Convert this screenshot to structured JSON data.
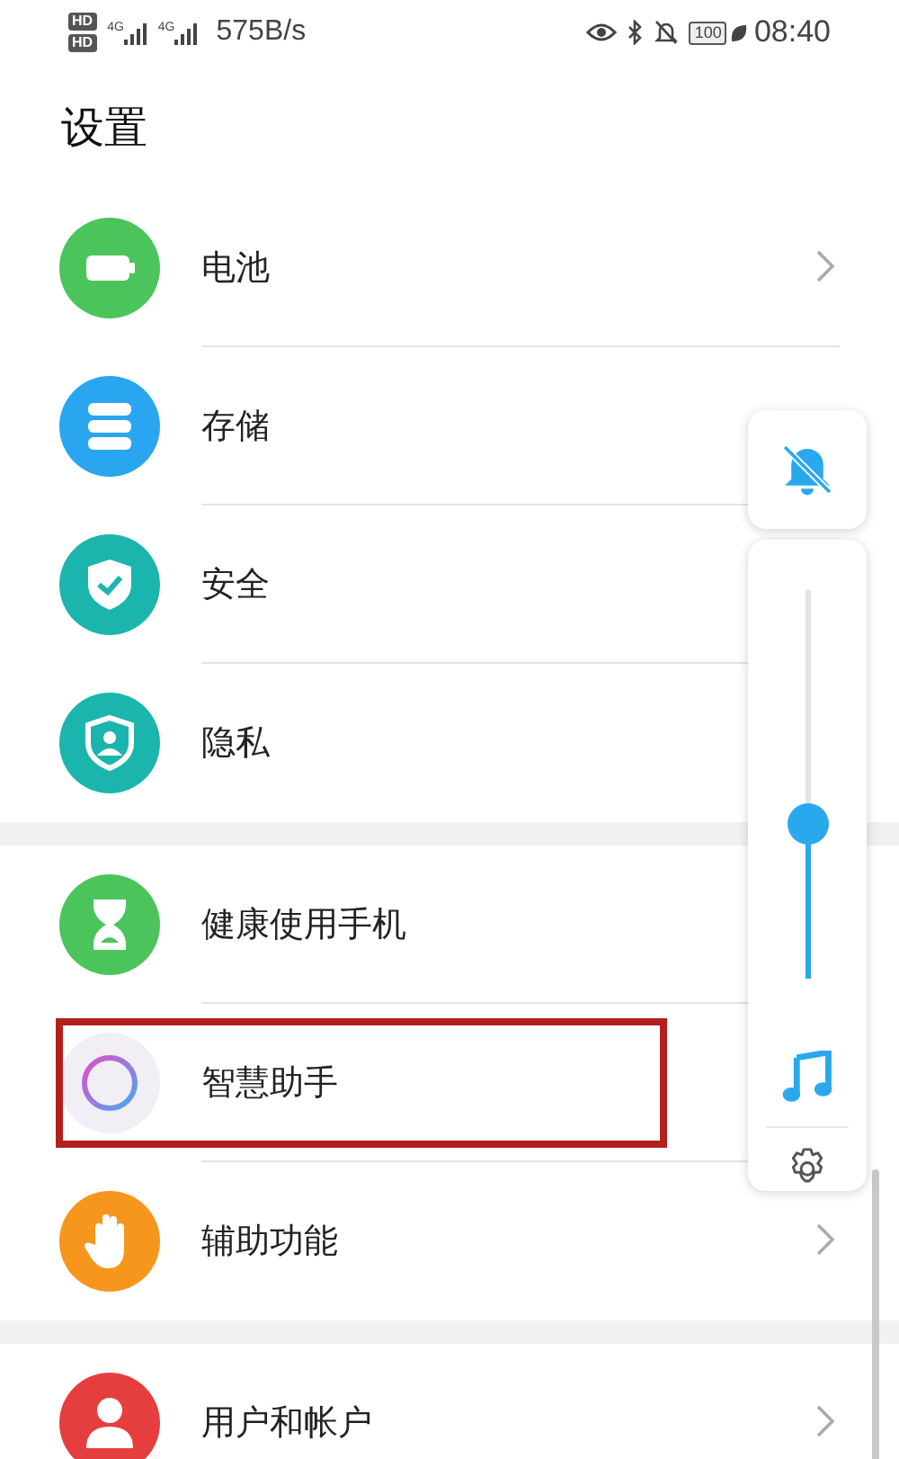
{
  "status_bar": {
    "hd_badges": [
      "HD",
      "HD"
    ],
    "network_types": [
      "4G",
      "4G"
    ],
    "speed": "575B/s",
    "battery": "100",
    "time": "08:40"
  },
  "title": "设置",
  "groups": [
    {
      "rows": [
        {
          "kind": "battery",
          "label": "电池",
          "color": "#4cc45c",
          "chevron": true,
          "highlighted": false
        },
        {
          "kind": "storage",
          "label": "存储",
          "color": "#2aa5f0",
          "chevron": false,
          "highlighted": false
        },
        {
          "kind": "security",
          "label": "安全",
          "color": "#1bb5ad",
          "chevron": false,
          "highlighted": false
        },
        {
          "kind": "privacy",
          "label": "隐私",
          "color": "#1bb5ad",
          "chevron": false,
          "highlighted": false
        }
      ]
    },
    {
      "rows": [
        {
          "kind": "health",
          "label": "健康使用手机",
          "color": "#4cc45c",
          "chevron": false,
          "highlighted": false
        },
        {
          "kind": "assistant",
          "label": "智慧助手",
          "color": "#f1eef6",
          "chevron": false,
          "highlighted": true
        },
        {
          "kind": "accessibility",
          "label": "辅助功能",
          "color": "#f7961c",
          "chevron": true,
          "highlighted": false
        }
      ]
    },
    {
      "rows": [
        {
          "kind": "user",
          "label": "用户和帐户",
          "color": "#e63e3e",
          "chevron": true,
          "highlighted": false
        }
      ]
    }
  ],
  "volume": {
    "ringer_muted": true,
    "level": 0.4
  }
}
